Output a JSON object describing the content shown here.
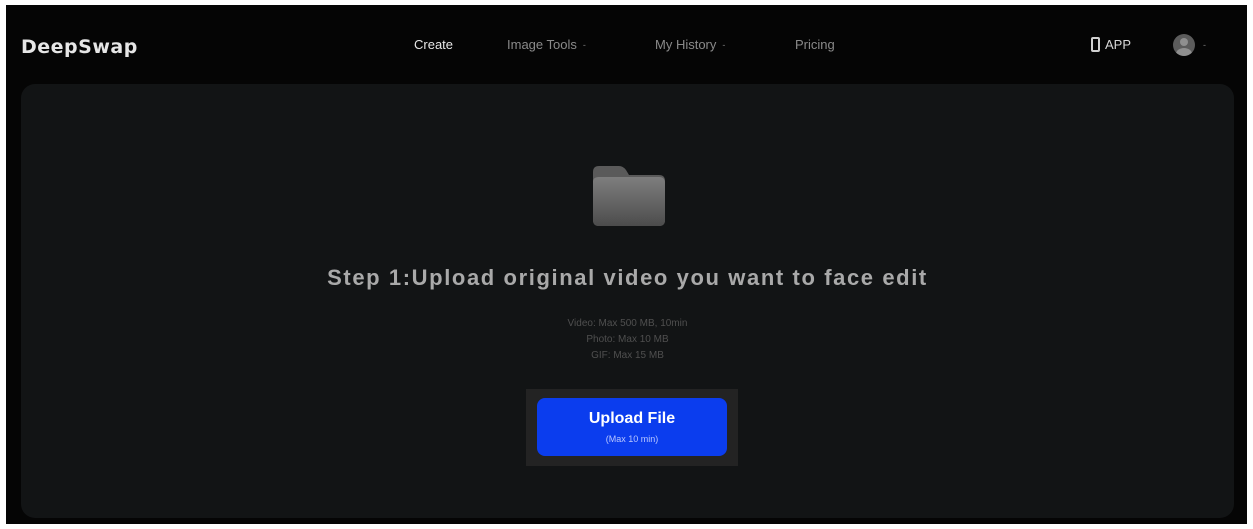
{
  "header": {
    "logo": "DeepSwap",
    "nav": [
      {
        "label": "Create",
        "active": true,
        "has_dropdown": false
      },
      {
        "label": "Image Tools",
        "active": false,
        "has_dropdown": true
      },
      {
        "label": "My History",
        "active": false,
        "has_dropdown": true
      },
      {
        "label": "Pricing",
        "active": false,
        "has_dropdown": false
      }
    ],
    "app_label": "APP",
    "dropdown_caret": "-"
  },
  "main": {
    "icon": "folder-icon",
    "title": "Step 1:Upload original video you want to face edit",
    "limits": [
      "Video: Max 500 MB, 10min",
      "Photo: Max 10 MB",
      "GIF: Max 15 MB"
    ],
    "upload": {
      "label": "Upload File",
      "sublabel": "(Max 10 min)"
    }
  },
  "colors": {
    "background": "#050505",
    "panel": "#121415",
    "accent": "#0b3dee"
  }
}
